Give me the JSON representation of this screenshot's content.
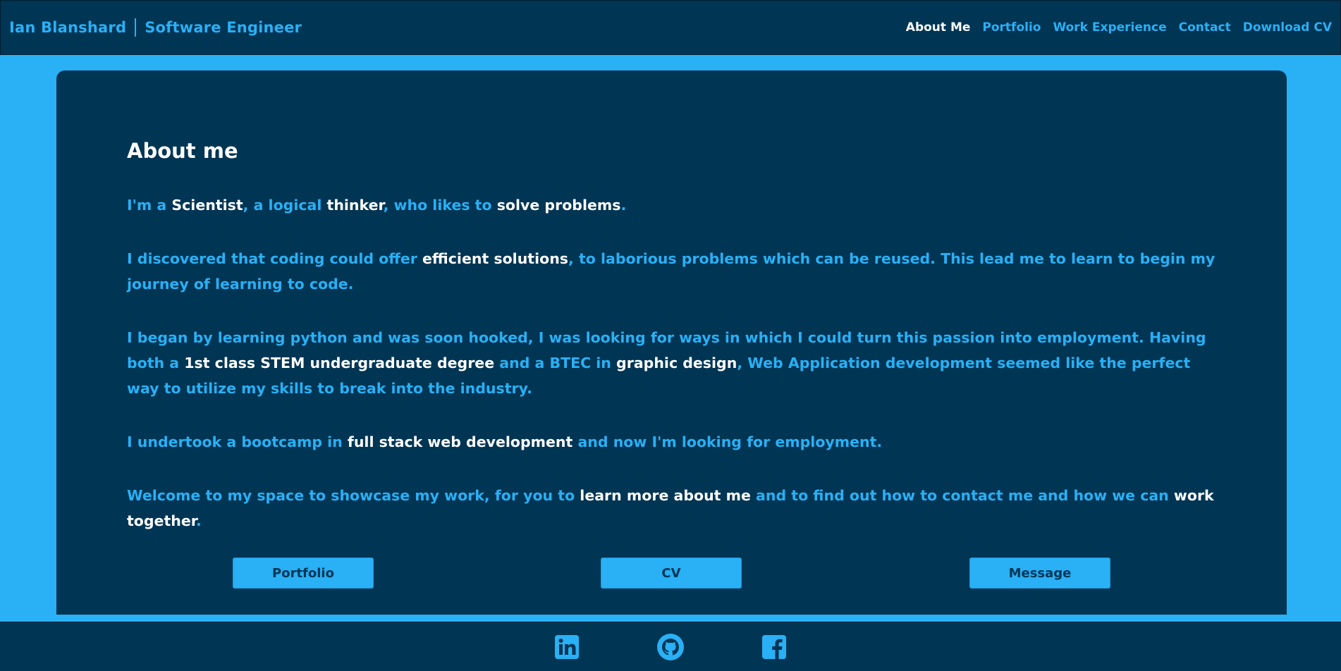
{
  "header": {
    "name": "Ian Blanshard",
    "role": "Software Engineer",
    "nav": [
      {
        "label": "About Me",
        "active": true
      },
      {
        "label": "Portfolio"
      },
      {
        "label": "Work Experience"
      },
      {
        "label": "Contact"
      },
      {
        "label": "Download CV"
      }
    ]
  },
  "main": {
    "title": "About me",
    "paragraphs": [
      [
        {
          "t": "I'm a "
        },
        {
          "t": "Scientist",
          "w": true
        },
        {
          "t": ", a logical "
        },
        {
          "t": "thinker",
          "w": true
        },
        {
          "t": ", who likes to "
        },
        {
          "t": "solve problems",
          "w": true
        },
        {
          "t": "."
        }
      ],
      [
        {
          "t": "I discovered that coding could offer "
        },
        {
          "t": "efficient solutions",
          "w": true
        },
        {
          "t": ", to laborious problems which can be reused. This lead me to learn to begin my journey of learning to code."
        }
      ],
      [
        {
          "t": "I began by learning python and was soon hooked, I was looking for ways in which I could turn this passion into employment. Having both a "
        },
        {
          "t": "1st class STEM undergraduate degree",
          "w": true
        },
        {
          "t": " and a BTEC in "
        },
        {
          "t": "graphic design",
          "w": true
        },
        {
          "t": ", Web Application development seemed like the perfect way to utilize my skills to break into the industry."
        }
      ],
      [
        {
          "t": "I undertook a bootcamp in "
        },
        {
          "t": "full stack web development",
          "w": true
        },
        {
          "t": " and now I'm looking for employment."
        }
      ],
      [
        {
          "t": "Welcome to my space to showcase my work, for you to "
        },
        {
          "t": "learn more about me",
          "w": true
        },
        {
          "t": " and to find out how to contact me and how we can "
        },
        {
          "t": "work together",
          "w": true
        },
        {
          "t": "."
        }
      ]
    ],
    "buttons": {
      "portfolio": "Portfolio",
      "cv": "CV",
      "message": "Message"
    }
  },
  "footer": {
    "icons": [
      "linkedin-icon",
      "github-icon",
      "facebook-icon"
    ]
  },
  "colors": {
    "dark": "#003554",
    "accent": "#29b0f5",
    "highlight": "#ffffff"
  }
}
